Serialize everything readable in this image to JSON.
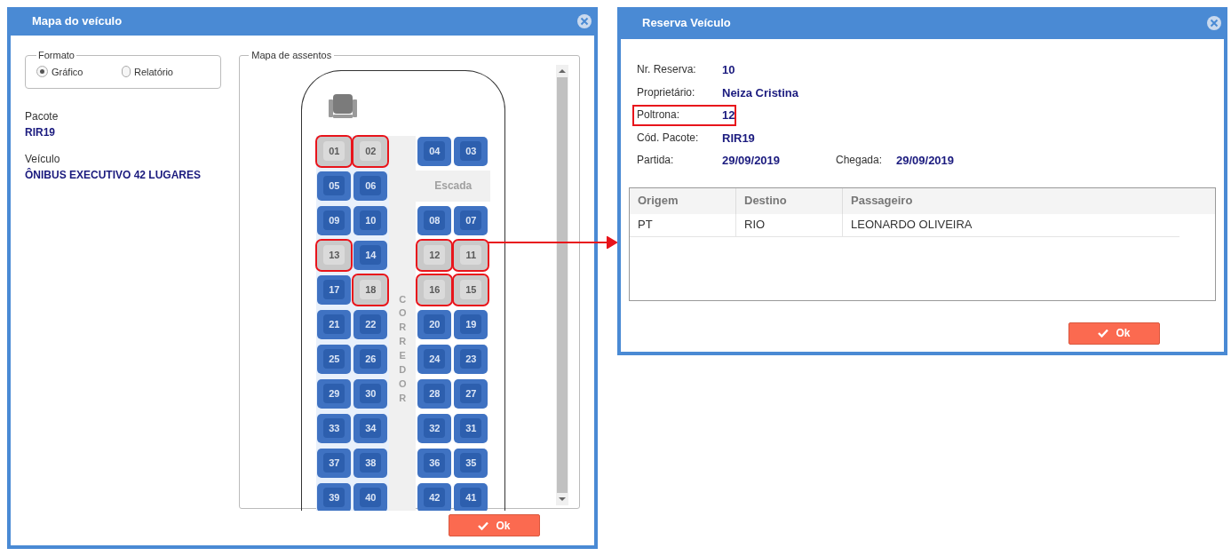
{
  "vehicle_map": {
    "title": "Mapa do veículo",
    "format": {
      "legend": "Formato",
      "options": [
        {
          "label": "Gráfico",
          "selected": true
        },
        {
          "label": "Relatório",
          "selected": false
        }
      ]
    },
    "package": {
      "label": "Pacote",
      "value": "RIR19"
    },
    "vehicle": {
      "label": "Veículo",
      "value": "ÔNIBUS EXECUTIVO 42 LUGARES"
    },
    "seat_map": {
      "legend": "Mapa de assentos",
      "aisle_label": "CORREDOR",
      "rows": [
        {
          "left": [
            {
              "number": "01",
              "occupied": true,
              "highlighted": true
            },
            {
              "number": "02",
              "occupied": true,
              "highlighted": true
            }
          ],
          "right": {
            "kind": "seats",
            "seats": [
              {
                "number": "04",
                "occupied": false,
                "highlighted": false
              },
              {
                "number": "03",
                "occupied": false,
                "highlighted": false
              }
            ]
          }
        },
        {
          "left": [
            {
              "number": "05",
              "occupied": false,
              "highlighted": false
            },
            {
              "number": "06",
              "occupied": false,
              "highlighted": false
            }
          ],
          "right": {
            "kind": "stairs",
            "label": "Escada"
          }
        },
        {
          "left": [
            {
              "number": "09",
              "occupied": false,
              "highlighted": false
            },
            {
              "number": "10",
              "occupied": false,
              "highlighted": false
            }
          ],
          "right": {
            "kind": "seats",
            "seats": [
              {
                "number": "08",
                "occupied": false,
                "highlighted": false
              },
              {
                "number": "07",
                "occupied": false,
                "highlighted": false
              }
            ]
          }
        },
        {
          "left": [
            {
              "number": "13",
              "occupied": true,
              "highlighted": true
            },
            {
              "number": "14",
              "occupied": false,
              "highlighted": false
            }
          ],
          "right": {
            "kind": "seats",
            "seats": [
              {
                "number": "12",
                "occupied": true,
                "highlighted": true
              },
              {
                "number": "11",
                "occupied": true,
                "highlighted": true
              }
            ]
          }
        },
        {
          "left": [
            {
              "number": "17",
              "occupied": false,
              "highlighted": false
            },
            {
              "number": "18",
              "occupied": true,
              "highlighted": true
            }
          ],
          "right": {
            "kind": "seats",
            "seats": [
              {
                "number": "16",
                "occupied": true,
                "highlighted": true
              },
              {
                "number": "15",
                "occupied": true,
                "highlighted": true
              }
            ]
          }
        },
        {
          "left": [
            {
              "number": "21",
              "occupied": false,
              "highlighted": false
            },
            {
              "number": "22",
              "occupied": false,
              "highlighted": false
            }
          ],
          "right": {
            "kind": "seats",
            "seats": [
              {
                "number": "20",
                "occupied": false,
                "highlighted": false
              },
              {
                "number": "19",
                "occupied": false,
                "highlighted": false
              }
            ]
          }
        },
        {
          "left": [
            {
              "number": "25",
              "occupied": false,
              "highlighted": false
            },
            {
              "number": "26",
              "occupied": false,
              "highlighted": false
            }
          ],
          "right": {
            "kind": "seats",
            "seats": [
              {
                "number": "24",
                "occupied": false,
                "highlighted": false
              },
              {
                "number": "23",
                "occupied": false,
                "highlighted": false
              }
            ]
          }
        },
        {
          "left": [
            {
              "number": "29",
              "occupied": false,
              "highlighted": false
            },
            {
              "number": "30",
              "occupied": false,
              "highlighted": false
            }
          ],
          "right": {
            "kind": "seats",
            "seats": [
              {
                "number": "28",
                "occupied": false,
                "highlighted": false
              },
              {
                "number": "27",
                "occupied": false,
                "highlighted": false
              }
            ]
          }
        },
        {
          "left": [
            {
              "number": "33",
              "occupied": false,
              "highlighted": false
            },
            {
              "number": "34",
              "occupied": false,
              "highlighted": false
            }
          ],
          "right": {
            "kind": "seats",
            "seats": [
              {
                "number": "32",
                "occupied": false,
                "highlighted": false
              },
              {
                "number": "31",
                "occupied": false,
                "highlighted": false
              }
            ]
          }
        },
        {
          "left": [
            {
              "number": "37",
              "occupied": false,
              "highlighted": false
            },
            {
              "number": "38",
              "occupied": false,
              "highlighted": false
            }
          ],
          "right": {
            "kind": "seats",
            "seats": [
              {
                "number": "36",
                "occupied": false,
                "highlighted": false
              },
              {
                "number": "35",
                "occupied": false,
                "highlighted": false
              }
            ]
          }
        },
        {
          "left": [
            {
              "number": "39",
              "occupied": false,
              "highlighted": false
            },
            {
              "number": "40",
              "occupied": false,
              "highlighted": false
            }
          ],
          "right": {
            "kind": "seats",
            "seats": [
              {
                "number": "42",
                "occupied": false,
                "highlighted": false
              },
              {
                "number": "41",
                "occupied": false,
                "highlighted": false
              }
            ]
          }
        }
      ]
    },
    "ok_button": "Ok"
  },
  "reservation": {
    "title": "Reserva Veículo",
    "fields": [
      {
        "label": "Nr. Reserva:",
        "value": "10",
        "highlighted": false
      },
      {
        "label": "Proprietário:",
        "value": "Neiza Cristina",
        "highlighted": false
      },
      {
        "label": "Poltrona:",
        "value": "12",
        "highlighted": true
      },
      {
        "label": "Cód. Pacote:",
        "value": "RIR19",
        "highlighted": false
      }
    ],
    "departure": {
      "label": "Partida:",
      "value": "29/09/2019"
    },
    "arrival": {
      "label": "Chegada:",
      "value": "29/09/2019"
    },
    "table": {
      "columns": [
        "Origem",
        "Destino",
        "Passageiro"
      ],
      "rows": [
        [
          "PT",
          "RIO",
          "LEONARDO OLIVEIRA"
        ]
      ]
    },
    "ok_button": "Ok"
  }
}
